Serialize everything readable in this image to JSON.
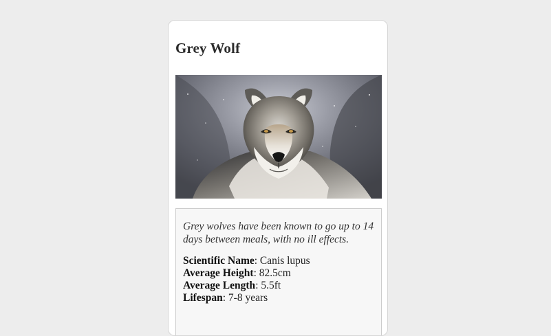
{
  "card": {
    "title": "Grey Wolf",
    "image_alt": "Grey wolf standing in snowy forest",
    "fact_quote": "Grey wolves have been known to go up to 14 days between meals, with no ill effects.",
    "stats": [
      {
        "label": "Scientific Name",
        "separator": ":",
        "value": "Canis lupus"
      },
      {
        "label": "Average Height",
        "separator": ":",
        "value": "82.5cm"
      },
      {
        "label": "Average Length",
        "separator": ":",
        "value": "5.5ft"
      },
      {
        "label": "Lifespan",
        "separator": ":",
        "value": "7-8 years"
      }
    ]
  },
  "colors": {
    "page_background": "#ededed",
    "card_background": "#ffffff",
    "facts_background": "#f7f7f7",
    "border": "#cccccc"
  }
}
